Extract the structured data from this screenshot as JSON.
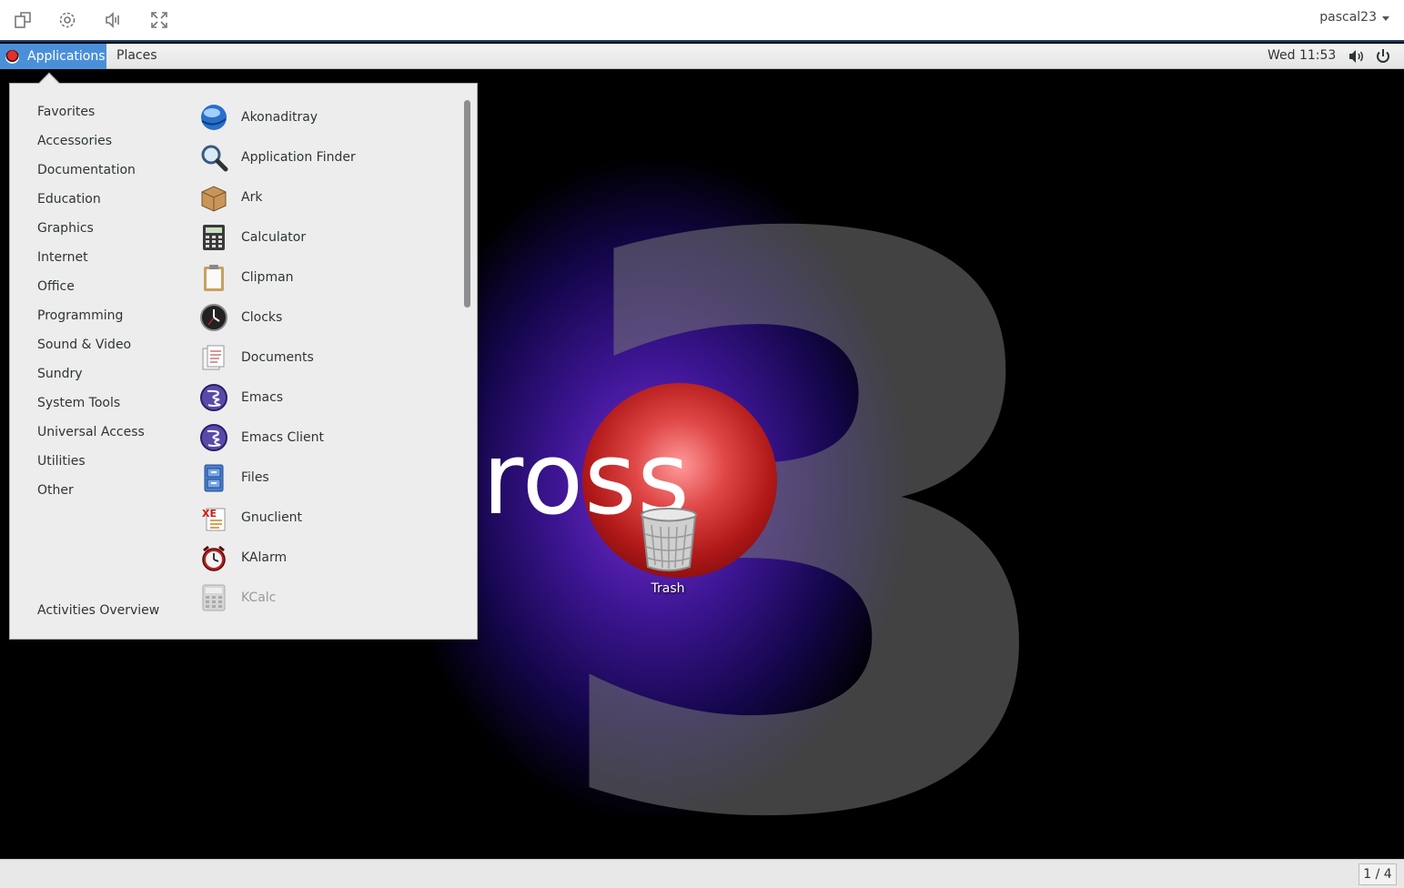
{
  "viewer_toolbar": {
    "buttons": [
      "screen-switch-icon",
      "settings-icon",
      "send-keys-icon",
      "fullscreen-icon"
    ],
    "user": "pascal23"
  },
  "top_bar": {
    "applications_label": "Applications",
    "places_label": "Places",
    "clock": "Wed 11:53",
    "accent": "#4a90d9"
  },
  "apps_menu": {
    "categories": [
      "Favorites",
      "Accessories",
      "Documentation",
      "Education",
      "Graphics",
      "Internet",
      "Office",
      "Programming",
      "Sound & Video",
      "Sundry",
      "System Tools",
      "Universal Access",
      "Utilities",
      "Other"
    ],
    "activities_label": "Activities Overview",
    "apps": [
      {
        "label": "Akonaditray",
        "icon": "akonaditray-icon"
      },
      {
        "label": "Application Finder",
        "icon": "magnifier-icon"
      },
      {
        "label": "Ark",
        "icon": "archive-box-icon"
      },
      {
        "label": "Calculator",
        "icon": "calculator-icon"
      },
      {
        "label": "Clipman",
        "icon": "clipboard-icon"
      },
      {
        "label": "Clocks",
        "icon": "clock-icon"
      },
      {
        "label": "Documents",
        "icon": "documents-icon"
      },
      {
        "label": "Emacs",
        "icon": "emacs-icon"
      },
      {
        "label": "Emacs Client",
        "icon": "emacs-icon"
      },
      {
        "label": "Files",
        "icon": "file-cabinet-icon"
      },
      {
        "label": "Gnuclient",
        "icon": "gnuclient-icon"
      },
      {
        "label": "KAlarm",
        "icon": "alarm-clock-icon"
      },
      {
        "label": "KCalc",
        "icon": "kcalc-icon"
      }
    ]
  },
  "desktop": {
    "brand_text": "ross",
    "trash_label": "Trash"
  },
  "bottom_bar": {
    "workspace": "1 / 4"
  }
}
